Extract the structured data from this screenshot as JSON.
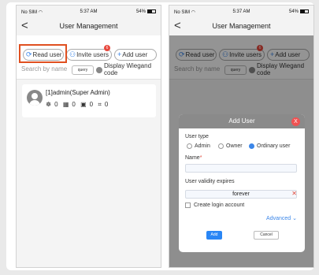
{
  "status": {
    "carrier": "No SIM",
    "time": "5:37 AM",
    "battery": "54%"
  },
  "nav": {
    "back": "<",
    "title": "User Management"
  },
  "toolbar": {
    "read": "Read user",
    "invite": "Invite users",
    "add": "Add user",
    "badge": "6"
  },
  "search": {
    "placeholder": "Search by name",
    "query": "query",
    "wiegand": "Display Wiegand code"
  },
  "user": {
    "name": "[1]admin(Super Admin)",
    "stats": [
      "0",
      "0",
      "0",
      "0"
    ]
  },
  "modal": {
    "title": "Add User",
    "close": "X",
    "user_type_label": "User type",
    "types": [
      "Admin",
      "Owner",
      "Ordinary user"
    ],
    "selected_type": "Ordinary user",
    "name_label": "Name",
    "name_required": "*",
    "validity_label": "User validity expires",
    "validity_value": "forever",
    "create_login": "Create login account",
    "advanced": "Advanced",
    "add": "Add",
    "cancel": "Cancel"
  },
  "colors": {
    "accent": "#3b86e8",
    "highlight": "#e05020",
    "danger": "#e04a3c",
    "primary_button": "#2a86f5"
  },
  "icons": [
    "wifi-icon",
    "battery-icon",
    "refresh-icon",
    "invite-icon",
    "plus-icon",
    "avatar-icon",
    "fingerprint-icon",
    "card-icon",
    "face-icon",
    "palm-icon",
    "close-icon",
    "chevron-down-icon"
  ]
}
